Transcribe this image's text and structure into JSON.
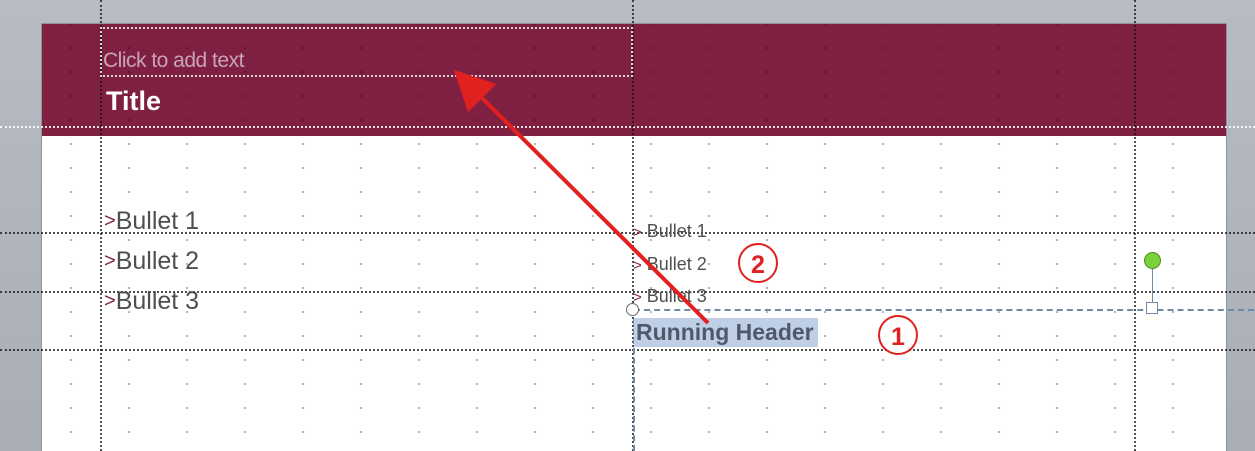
{
  "slide": {
    "placeholder_text": "Click to add text",
    "title": "Title",
    "left_bullets": [
      {
        "marker": ">",
        "text": "Bullet 1"
      },
      {
        "marker": ">",
        "text": "Bullet 2"
      },
      {
        "marker": ">",
        "text": "Bullet 3"
      }
    ],
    "right_bullets": [
      {
        "marker": ">",
        "text": "Bullet 1"
      },
      {
        "marker": ">",
        "text": "Bullet 2"
      },
      {
        "marker": ">",
        "text": "Bullet 3"
      }
    ],
    "running_header": "Running Header"
  },
  "callouts": {
    "one": "1",
    "two": "2"
  },
  "colors": {
    "banner": "#7f1f42",
    "selection": "#bfcfe6",
    "callout": "#e12020",
    "rotate_handle": "#79d23a"
  },
  "icons": {
    "rotate_handle": "rotate-handle-icon",
    "resize_handle": "resize-handle-icon",
    "arrow": "arrow-icon"
  }
}
